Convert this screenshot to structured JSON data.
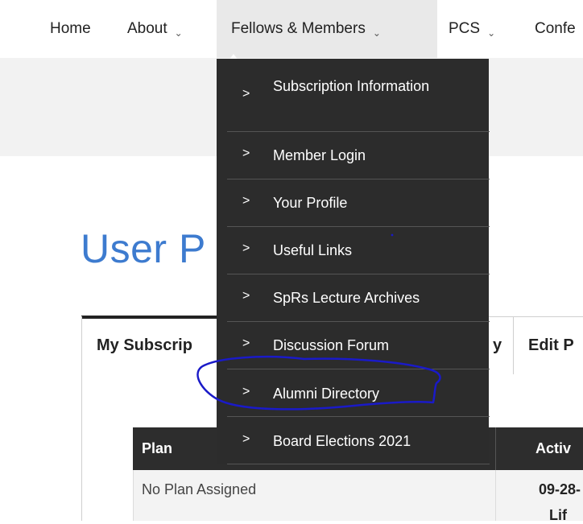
{
  "nav": {
    "items": [
      {
        "label": "Home",
        "has_dropdown": false
      },
      {
        "label": "About",
        "has_dropdown": true
      },
      {
        "label": "Fellows & Members",
        "has_dropdown": true
      },
      {
        "label": "PCS",
        "has_dropdown": true
      },
      {
        "label": "Confe",
        "has_dropdown": false
      }
    ]
  },
  "dropdown": {
    "items": [
      {
        "label": "Subscription Information"
      },
      {
        "label": "Member Login"
      },
      {
        "label": "Your Profile"
      },
      {
        "label": "Useful Links"
      },
      {
        "label": "SpRs Lecture Archives"
      },
      {
        "label": "Discussion Forum"
      },
      {
        "label": "Alumni Directory"
      },
      {
        "label": "Board Elections 2021"
      }
    ],
    "arrow_glyph": ">",
    "highlighted": "Alumni Directory"
  },
  "page": {
    "title": "User P"
  },
  "tabs": [
    {
      "label": "My Subscrip",
      "active": true
    },
    {
      "label": "y",
      "active": false
    },
    {
      "label": "Edit P",
      "active": false
    }
  ],
  "table": {
    "headers": [
      "Plan",
      "Activ"
    ],
    "rows": [
      {
        "plan": "No Plan Assigned",
        "date": "09-28-",
        "note": "Lif"
      }
    ]
  },
  "colors": {
    "dropdown_bg": "#2c2c2c",
    "title_blue": "#3d7bcf",
    "annotation": "#1a1ac8",
    "active_nav_bg": "#e9e9e9"
  },
  "icons": {
    "dropdown_chevron": "chevron-down-icon",
    "menu_arrow": "chevron-right-icon"
  }
}
